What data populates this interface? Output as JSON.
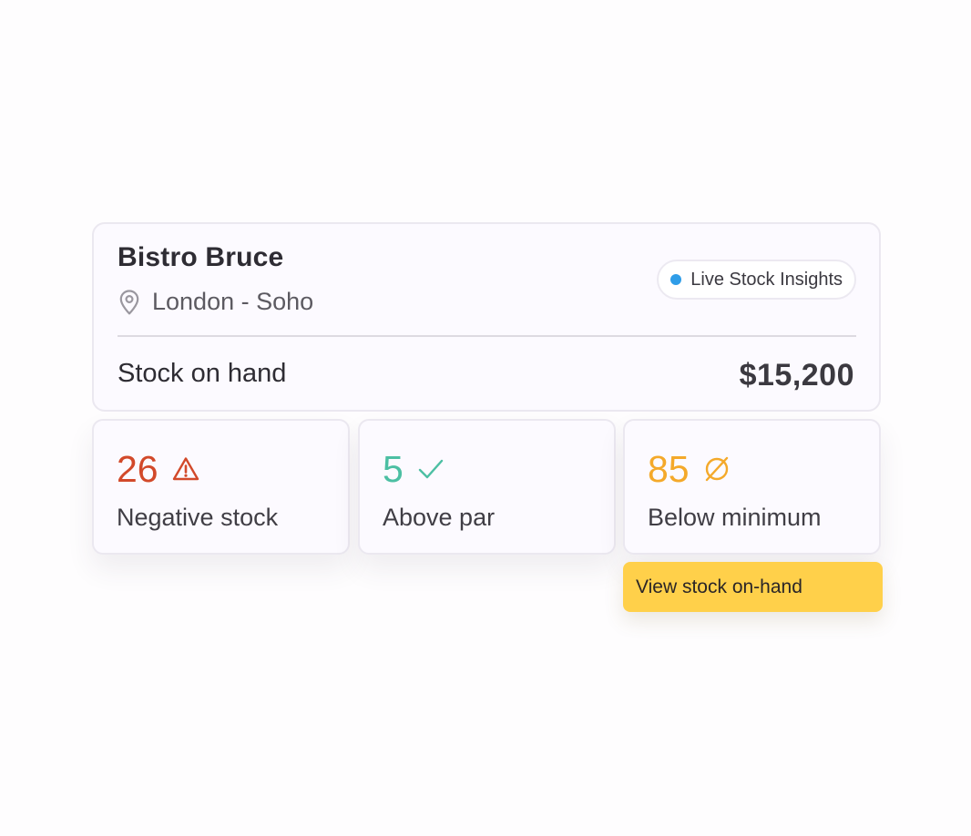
{
  "venue": {
    "name": "Bistro Bruce",
    "location": "London - Soho",
    "location_icon": "map-pin-icon"
  },
  "badge": {
    "label": "Live Stock Insights",
    "dot_color": "#2f9de8"
  },
  "summary": {
    "label": "Stock on hand",
    "value": "$15,200"
  },
  "stats": [
    {
      "value": "26",
      "label": "Negative stock",
      "icon": "warning-triangle-icon",
      "color": "#d2492a"
    },
    {
      "value": "5",
      "label": "Above par",
      "icon": "checkmark-icon",
      "color": "#4cbfa3"
    },
    {
      "value": "85",
      "label": "Below minimum",
      "icon": "empty-set-icon",
      "color": "#f4a92a"
    }
  ],
  "cta": {
    "label": "View stock on-hand",
    "color": "#ffd04a"
  }
}
